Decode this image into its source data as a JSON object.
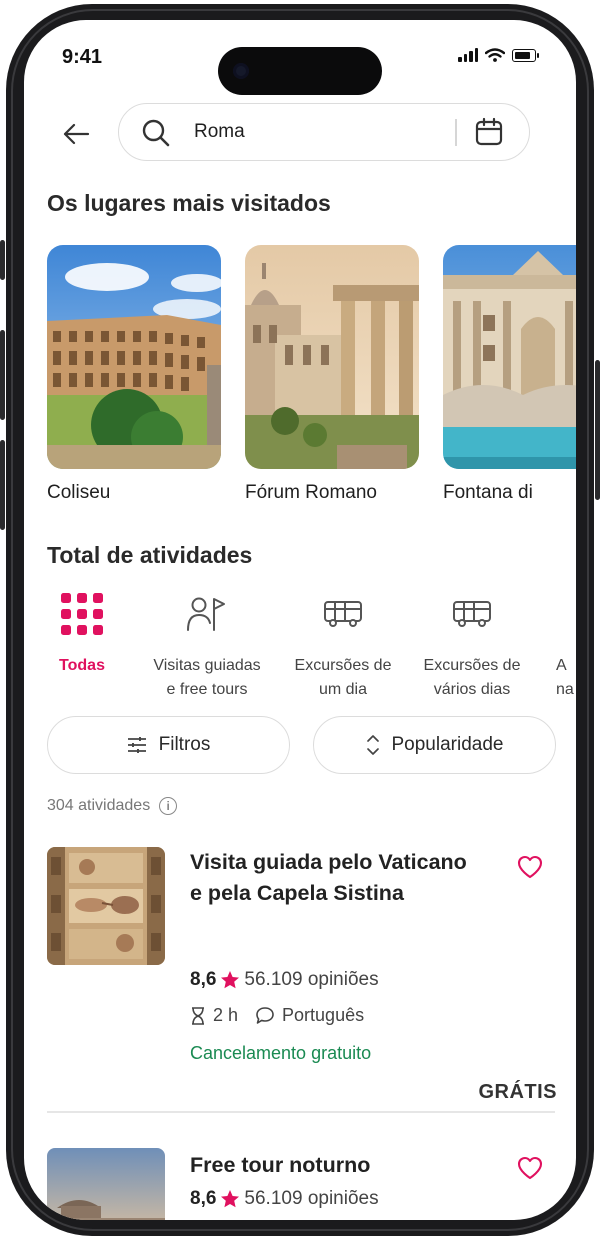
{
  "status": {
    "time": "9:41"
  },
  "search": {
    "value": "Roma"
  },
  "places_section": {
    "title": "Os lugares mais visitados",
    "items": [
      {
        "label": "Coliseu"
      },
      {
        "label": "Fórum Romano"
      },
      {
        "label": "Fontana di"
      }
    ]
  },
  "activities_section": {
    "title": "Total de atividades",
    "categories": [
      {
        "line1": "Todas",
        "line2": "",
        "icon": "grid-icon"
      },
      {
        "line1": "Visitas guiadas",
        "line2": "e free tours",
        "icon": "guide-flag-icon"
      },
      {
        "line1": "Excursões de",
        "line2": "um dia",
        "icon": "bus-icon"
      },
      {
        "line1": "Excursões de",
        "line2": "vários dias",
        "icon": "bus-icon"
      },
      {
        "line1": "A",
        "line2": "na",
        "icon": ""
      }
    ]
  },
  "filters": {
    "filter_label": "Filtros",
    "sort_label": "Popularidade"
  },
  "results": {
    "count": "304 atividades",
    "info": "i"
  },
  "activities": [
    {
      "title": "Visita guiada pelo Vaticano e pela Capela Sistina",
      "score": "8,6",
      "reviews": "56.109 opiniões",
      "duration": "2 h",
      "language": "Português",
      "cancellation": "Cancelamento gratuito",
      "price": "GRÁTIS"
    },
    {
      "title": "Free tour noturno",
      "score": "8,6",
      "reviews": "56.109 opiniões"
    }
  ],
  "colors": {
    "accent": "#e0115f",
    "success": "#1a8a52",
    "text": "#222222"
  }
}
